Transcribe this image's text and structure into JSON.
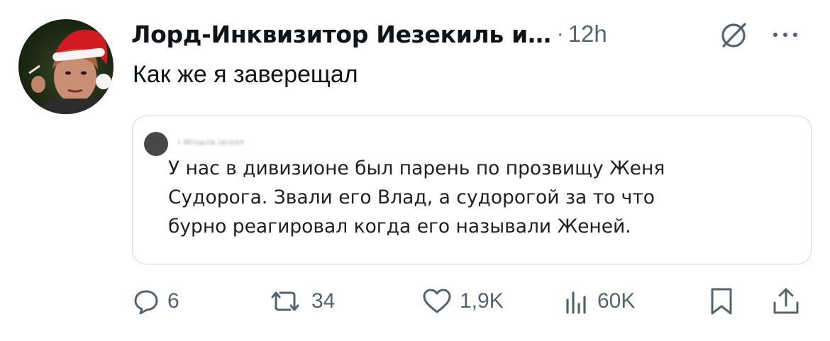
{
  "author": {
    "name": "Лорд-Инквизитор Иезекиль и…",
    "separator": "·",
    "time": "12h"
  },
  "tweet": {
    "text": "Как же я заверещал"
  },
  "media": {
    "username": "i·Мiчшла.iагоол",
    "lines": [
      "У нас в дивизионе был парень по прозвищу Женя",
      "Судорога. Звали его Влад, а судорогой за то что",
      "бурно реагировал когда его называли Женей."
    ]
  },
  "actions": {
    "replies": "6",
    "reposts": "34",
    "likes": "1,9K",
    "views": "60K"
  },
  "icons": {
    "grok": "grok-icon",
    "more": "more-icon",
    "reply": "reply-icon",
    "repost": "repost-icon",
    "like": "heart-icon",
    "views": "views-icon",
    "bookmark": "bookmark-icon",
    "share": "share-icon"
  },
  "colors": {
    "text_primary": "#0f1419",
    "text_secondary": "#536471",
    "border": "#cfd9de"
  }
}
